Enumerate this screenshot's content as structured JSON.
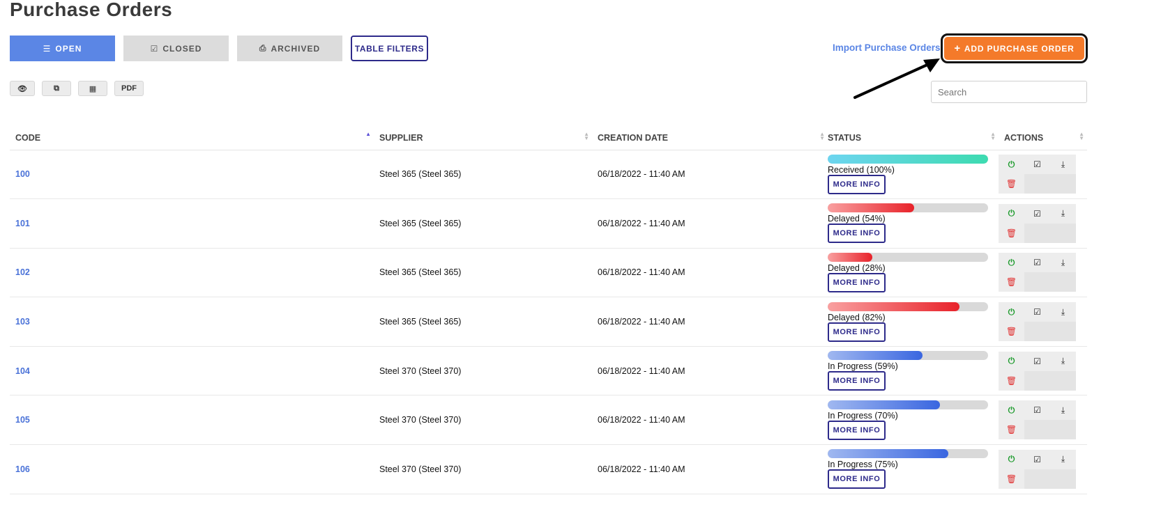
{
  "page_title": "Purchase Orders",
  "tabs": [
    {
      "label": "OPEN",
      "icon": "list-icon",
      "glyph": "☰",
      "active": true
    },
    {
      "label": "CLOSED",
      "icon": "check-square-icon",
      "glyph": "☑",
      "active": false
    },
    {
      "label": "ARCHIVED",
      "icon": "inbox-icon",
      "glyph": "⎙",
      "active": false
    }
  ],
  "table_filters_label": "TABLE FILTERS",
  "import_link": "Import Purchase Orders",
  "add_button": {
    "label": "ADD PURCHASE ORDER",
    "icon": "plus-icon",
    "glyph": "+"
  },
  "tools": [
    {
      "name": "view-toggle-button",
      "glyph": "👁",
      "icon": "eye-icon"
    },
    {
      "name": "copy-button",
      "glyph": "⧉",
      "icon": "copy-icon"
    },
    {
      "name": "export-csv-button",
      "glyph": "▦",
      "icon": "table-icon"
    },
    {
      "name": "export-pdf-button",
      "glyph": "PDF",
      "icon": ""
    }
  ],
  "search": {
    "placeholder": "Search"
  },
  "columns": {
    "code": "CODE",
    "supplier": "SUPPLIER",
    "creation_date": "CREATION DATE",
    "status": "STATUS",
    "actions": "ACTIONS"
  },
  "colors": {
    "accent": "#5b86e5",
    "brand_orange": "#f47a2a",
    "navy": "#2d2a8a",
    "received_from": "#6dd5f0",
    "received_to": "#3ddbb0",
    "delayed_from": "#f9a0a0",
    "delayed_to": "#e8222a",
    "progress_from": "#a0b8f0",
    "progress_to": "#3a66e0"
  },
  "rows": [
    {
      "code": "100",
      "supplier": "Steel 365 (Steel 365)",
      "date": "06/18/2022 - 11:40 AM",
      "status": "Received (100%)",
      "kind": "received",
      "progress": 100
    },
    {
      "code": "101",
      "supplier": "Steel 365 (Steel 365)",
      "date": "06/18/2022 - 11:40 AM",
      "status": "Delayed (54%)",
      "kind": "delayed",
      "progress": 54
    },
    {
      "code": "102",
      "supplier": "Steel 365 (Steel 365)",
      "date": "06/18/2022 - 11:40 AM",
      "status": "Delayed (28%)",
      "kind": "delayed",
      "progress": 28
    },
    {
      "code": "103",
      "supplier": "Steel 365 (Steel 365)",
      "date": "06/18/2022 - 11:40 AM",
      "status": "Delayed (82%)",
      "kind": "delayed",
      "progress": 82
    },
    {
      "code": "104",
      "supplier": "Steel 370 (Steel 370)",
      "date": "06/18/2022 - 11:40 AM",
      "status": "In Progress (59%)",
      "kind": "progress",
      "progress": 59
    },
    {
      "code": "105",
      "supplier": "Steel 370 (Steel 370)",
      "date": "06/18/2022 - 11:40 AM",
      "status": "In Progress (70%)",
      "kind": "progress",
      "progress": 70
    },
    {
      "code": "106",
      "supplier": "Steel 370 (Steel 370)",
      "date": "06/18/2022 - 11:40 AM",
      "status": "In Progress (75%)",
      "kind": "progress",
      "progress": 75
    }
  ],
  "more_info_label": "MORE INFO",
  "action_icons": {
    "power": "⏻",
    "check": "☑",
    "download": "⤓",
    "trash": "🗑"
  }
}
